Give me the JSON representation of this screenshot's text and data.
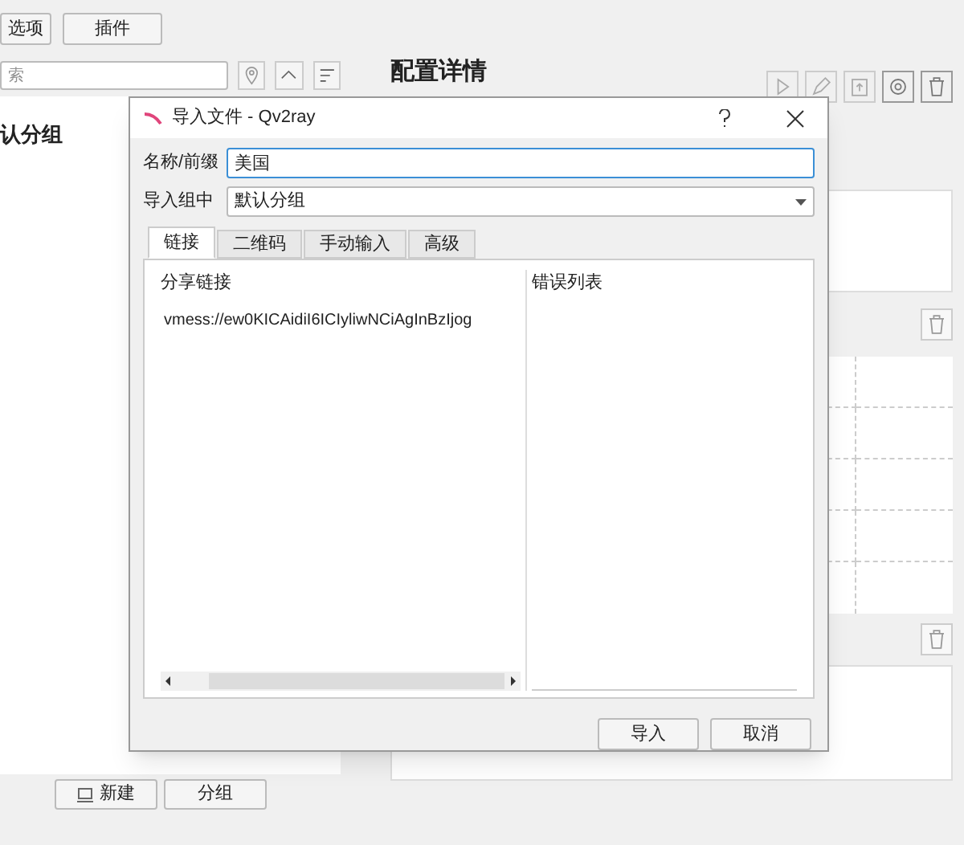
{
  "main": {
    "top_buttons": [
      "选项",
      "插件"
    ],
    "search": {
      "placeholder": "索"
    },
    "group_heading": "认分组",
    "bottom_buttons": [
      {
        "label": "新建",
        "kind": "icon"
      },
      {
        "label": "分组",
        "kind": "plain"
      }
    ],
    "details_title": "配置详情"
  },
  "dialog": {
    "title": "导入文件 - Qv2ray",
    "name_label": "名称/前缀",
    "name_value": "美国",
    "group_label": "导入组中",
    "group_value": "默认分组",
    "tabs": [
      {
        "label": "链接",
        "selected": true
      },
      {
        "label": "二维码",
        "selected": false
      },
      {
        "label": "手动输入",
        "selected": false
      },
      {
        "label": "高级",
        "selected": false
      }
    ],
    "share_label": "分享链接",
    "share_link": "vmess://ew0KICAidiI6ICIyliwNCiAgInBzIjog",
    "error_label": "错误列表",
    "buttons": [
      "导入",
      "取消"
    ]
  }
}
